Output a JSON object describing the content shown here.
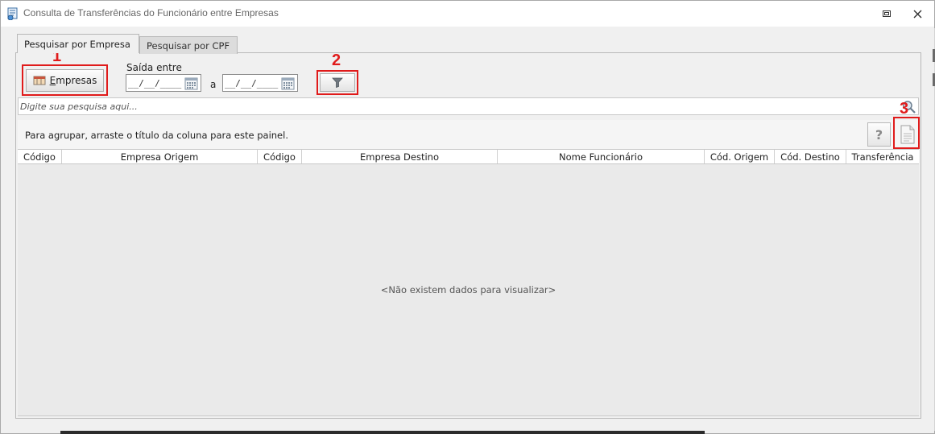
{
  "window": {
    "title": "Consulta de Transferências do Funcionário entre Empresas",
    "icon": "report-icon"
  },
  "tabs": [
    {
      "label": "Pesquisar por Empresa",
      "active": true
    },
    {
      "label": "Pesquisar por CPF",
      "active": false
    }
  ],
  "toolbar": {
    "empresas_label_underlined": "E",
    "empresas_label_rest": "mpresas",
    "saida_label": "Saída entre",
    "date_from_value": "__/__/____",
    "date_to_value": "__/__/____",
    "between_label": "a"
  },
  "search": {
    "placeholder": "Digite sua pesquisa aqui..."
  },
  "group_panel": {
    "hint": "Para agrupar, arraste o título da coluna para este painel.",
    "help_label": "?"
  },
  "grid": {
    "columns": [
      "Código",
      "Empresa Origem",
      "Código",
      "Empresa Destino",
      "Nome Funcionário",
      "Cód. Origem",
      "Cód. Destino",
      "Transferência"
    ],
    "empty_message": "<Não existem dados para visualizar>"
  },
  "annotations": {
    "n1": "1",
    "n2": "2",
    "n3": "3",
    "color": "#e01b1b"
  }
}
